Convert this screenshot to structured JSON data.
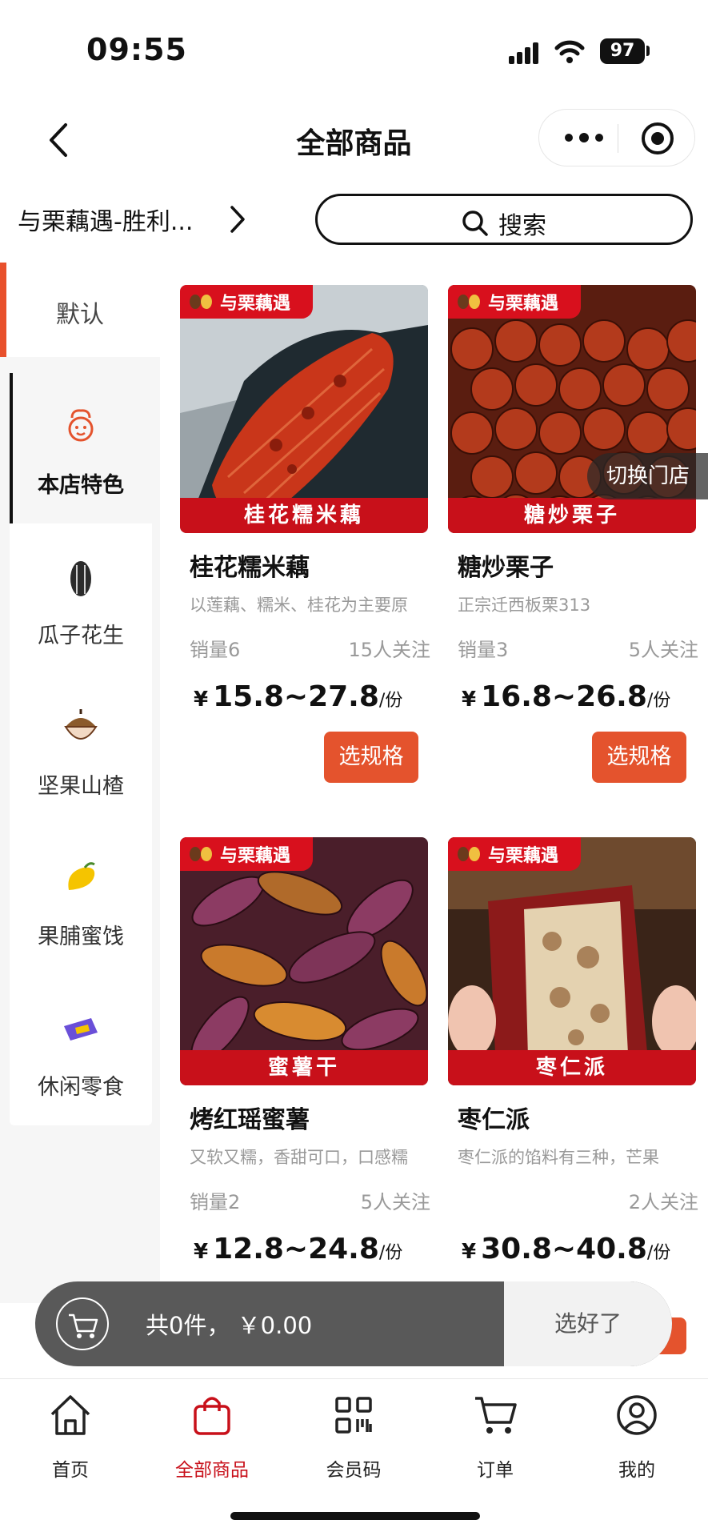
{
  "status_bar": {
    "time": "09:55",
    "battery": "97"
  },
  "header": {
    "title": "全部商品"
  },
  "store": {
    "name": "与栗藕遇-胜利...",
    "search_label": "搜索"
  },
  "sidebar": {
    "default_label": "默认",
    "items": [
      {
        "label": "本店特色",
        "icon": "chef-icon",
        "active": true
      },
      {
        "label": "瓜子花生",
        "icon": "sunflower-seed-icon"
      },
      {
        "label": "坚果山楂",
        "icon": "hazelnut-icon"
      },
      {
        "label": "果脯蜜饯",
        "icon": "mango-icon"
      },
      {
        "label": "休闲零食",
        "icon": "snack-bag-icon"
      }
    ]
  },
  "products": [
    {
      "brand": "与栗藕遇",
      "banner": "桂花糯米藕",
      "name": "桂花糯米藕",
      "desc": "以莲藕、糯米、桂花为主要原",
      "sales": "销量6",
      "follows": "15人关注",
      "currency": "¥",
      "price": "15.8~27.8",
      "unit": "/份",
      "button": "选规格"
    },
    {
      "brand": "与栗藕遇",
      "banner": "糖炒栗子",
      "name": "糖炒栗子",
      "desc": "正宗迁西板栗313",
      "sales": "销量3",
      "follows": "5人关注",
      "currency": "¥",
      "price": "16.8~26.8",
      "unit": "/份",
      "button": "选规格"
    },
    {
      "brand": "与栗藕遇",
      "banner": "蜜薯干",
      "name": "烤红瑶蜜薯",
      "desc": "又软又糯，香甜可口，口感糯",
      "sales": "销量2",
      "follows": "5人关注",
      "currency": "¥",
      "price": "12.8~24.8",
      "unit": "/份",
      "button": "选规格"
    },
    {
      "brand": "与栗藕遇",
      "banner": "枣仁派",
      "name": "枣仁派",
      "desc": "枣仁派的馅料有三种，芒果",
      "sales": "",
      "follows": "2人关注",
      "currency": "¥",
      "price": "30.8~40.8",
      "unit": "/份",
      "button": "选规格"
    }
  ],
  "switch_store": "切换门店",
  "cart": {
    "summary": "共0件，  ￥0.00",
    "checkout": "选好了"
  },
  "tabs": [
    {
      "label": "首页",
      "icon": "home-icon"
    },
    {
      "label": "全部商品",
      "icon": "shopping-bag-icon",
      "active": true
    },
    {
      "label": "会员码",
      "icon": "qr-code-icon"
    },
    {
      "label": "订单",
      "icon": "cart-icon"
    },
    {
      "label": "我的",
      "icon": "user-icon"
    }
  ],
  "colors": {
    "accent": "#e4532d",
    "brand_red": "#c8101a",
    "active_tab": "#c8101a"
  }
}
